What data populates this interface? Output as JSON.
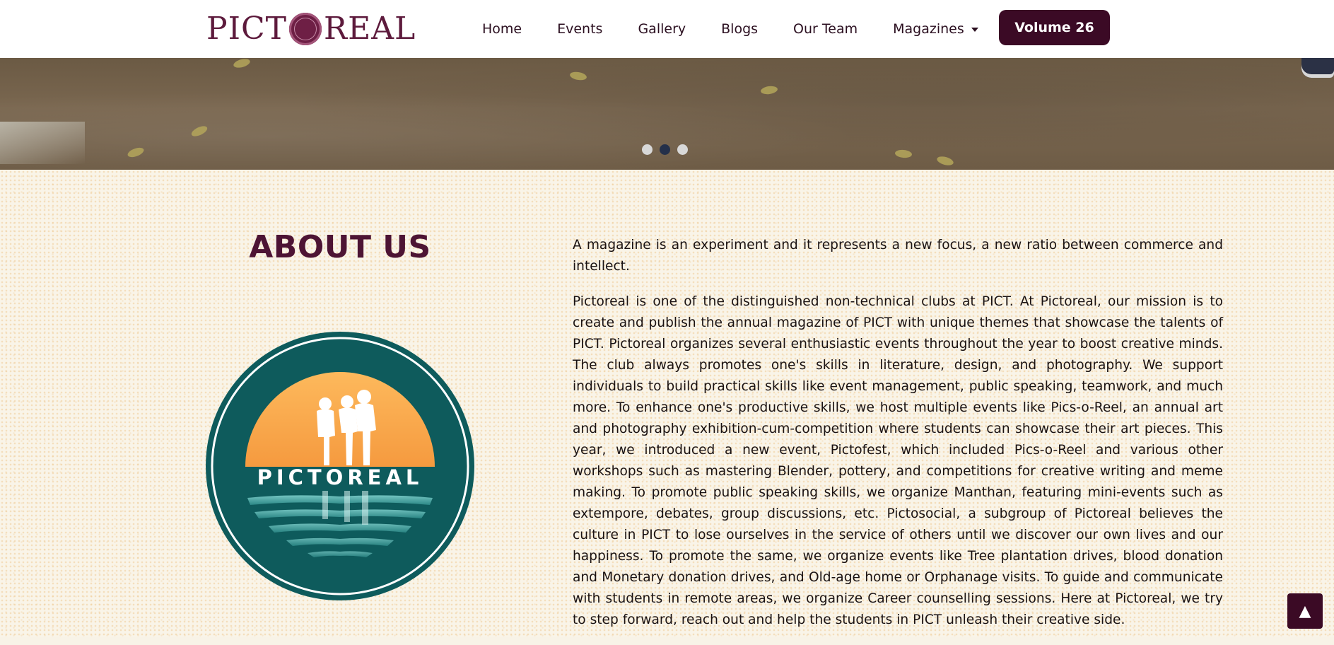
{
  "header": {
    "brand": {
      "left": "PICT",
      "right": "REAL"
    },
    "nav": [
      "Home",
      "Events",
      "Gallery",
      "Blogs",
      "Our Team",
      "Magazines"
    ],
    "cta": "Volume 26"
  },
  "hero": {
    "slides_total": 3,
    "active_slide": 2
  },
  "about": {
    "title": "ABOUT US",
    "logo_text": "PICTOREAL",
    "paragraphs": [
      "A magazine is an experiment and it represents a new focus, a new ratio between commerce and intellect.",
      "Pictoreal is one of the distinguished non-technical clubs at PICT. At Pictoreal, our mission is to create and publish the annual magazine of PICT with unique themes that showcase the talents of PICT. Pictoreal organizes several enthusiastic events throughout the year to boost creative minds. The club always promotes one's skills in literature, design, and photography. We support individuals to build practical skills like event management, public speaking, teamwork, and much more. To enhance one's productive skills, we host multiple events like Pics-o-Reel, an annual art and photography exhibition-cum-competition where students can showcase their art pieces. This year, we introduced a new event, Pictofest, which included Pics-o-Reel and various other workshops such as mastering Blender, pottery, and competitions for creative writing and meme making. To promote public speaking skills, we organize Manthan, featuring mini-events such as extempore, debates, group discussions, etc. Pictosocial, a subgroup of Pictoreal believes the culture in PICT to lose ourselves in the service of others until we discover our own lives and our happiness. To promote the same, we organize events like Tree plantation drives, blood donation and Monetary donation drives, and Old-age home or Orphanage visits. To guide and communicate with students in remote areas, we organize Career counselling sessions. Here at Pictoreal, we try to step forward, reach out and help the students in PICT unleash their creative side."
    ]
  },
  "scroll_top": {
    "icon": "arrow-up-icon",
    "glyph": "▲"
  },
  "colors": {
    "brand": "#5d1a3c",
    "button": "#3b0a25",
    "accent_orange": "#f6a84a",
    "logo_teal": "#0e5b5c"
  }
}
